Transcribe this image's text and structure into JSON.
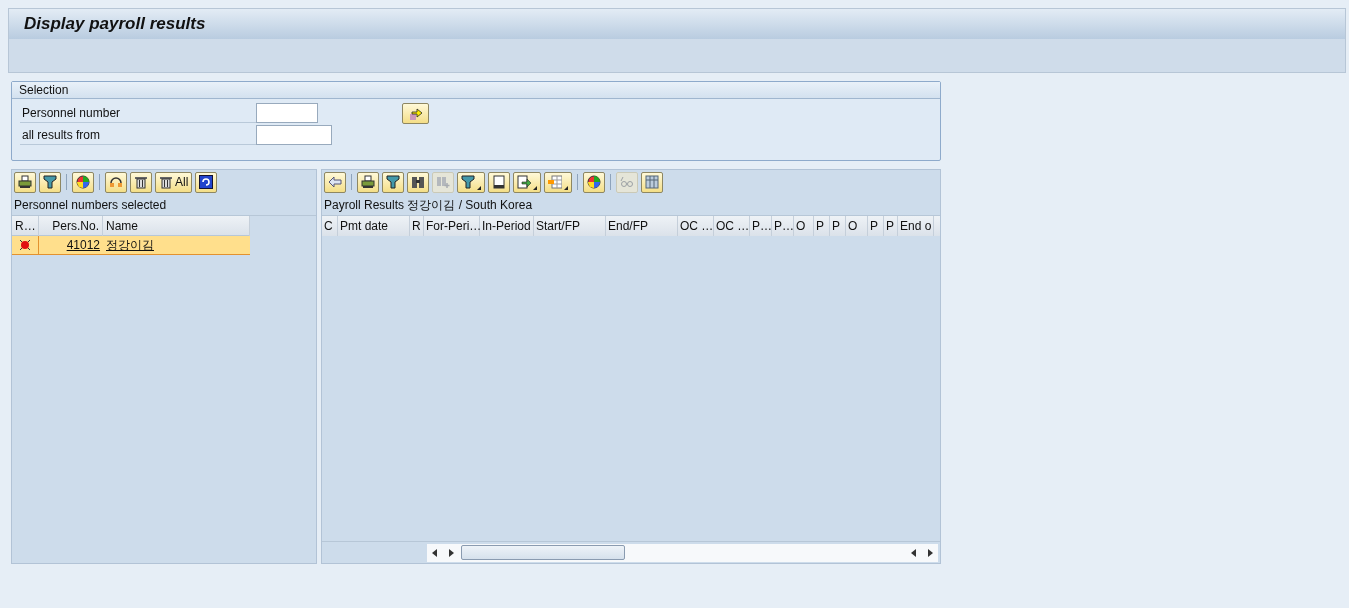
{
  "window": {
    "title": "Display payroll results"
  },
  "selection": {
    "title": "Selection",
    "fields": [
      {
        "label": "Personnel number"
      },
      {
        "label": "all results from"
      }
    ]
  },
  "left_panel": {
    "toolbar_groups": [
      [
        {
          "kind": "print",
          "disabled": false
        },
        {
          "kind": "filter",
          "disabled": false
        }
      ],
      [
        {
          "kind": "colors",
          "disabled": false
        }
      ],
      [
        {
          "kind": "select",
          "disabled": false
        },
        {
          "kind": "trash",
          "disabled": false
        },
        {
          "kind": "trash",
          "label": "All",
          "disabled": false
        },
        {
          "kind": "refresh",
          "disabled": false
        }
      ]
    ],
    "title": "Personnel numbers selected",
    "columns": [
      "R…",
      "Pers.No.",
      "Name"
    ],
    "rows": [
      {
        "color": "#e01010",
        "pers_no": "41012",
        "name": "정강이김",
        "selected": true
      }
    ]
  },
  "right_panel": {
    "toolbar_groups": [
      [
        {
          "kind": "back",
          "disabled": false
        }
      ],
      [
        {
          "kind": "print",
          "disabled": false
        },
        {
          "kind": "filter",
          "disabled": false
        },
        {
          "kind": "find",
          "disabled": false
        },
        {
          "kind": "find_next",
          "disabled": true
        },
        {
          "kind": "filter",
          "dropdown": true,
          "disabled": false
        },
        {
          "kind": "page",
          "disabled": false
        },
        {
          "kind": "export",
          "dropdown": true,
          "disabled": false
        },
        {
          "kind": "layout",
          "dropdown": true,
          "disabled": false
        }
      ],
      [
        {
          "kind": "colors",
          "disabled": false
        }
      ],
      [
        {
          "kind": "glasses",
          "disabled": true
        },
        {
          "kind": "grid",
          "disabled": false
        }
      ]
    ],
    "title": "Payroll Results 정강이김 / South Korea",
    "columns": [
      "C",
      "Pmt date",
      "R",
      "For-Peri…",
      "In-Period",
      "Start/FP",
      "End/FP",
      "OC …",
      "OC …",
      "P…",
      "P…",
      "O",
      "P",
      "P",
      "O",
      "P",
      "P",
      "End o"
    ]
  }
}
